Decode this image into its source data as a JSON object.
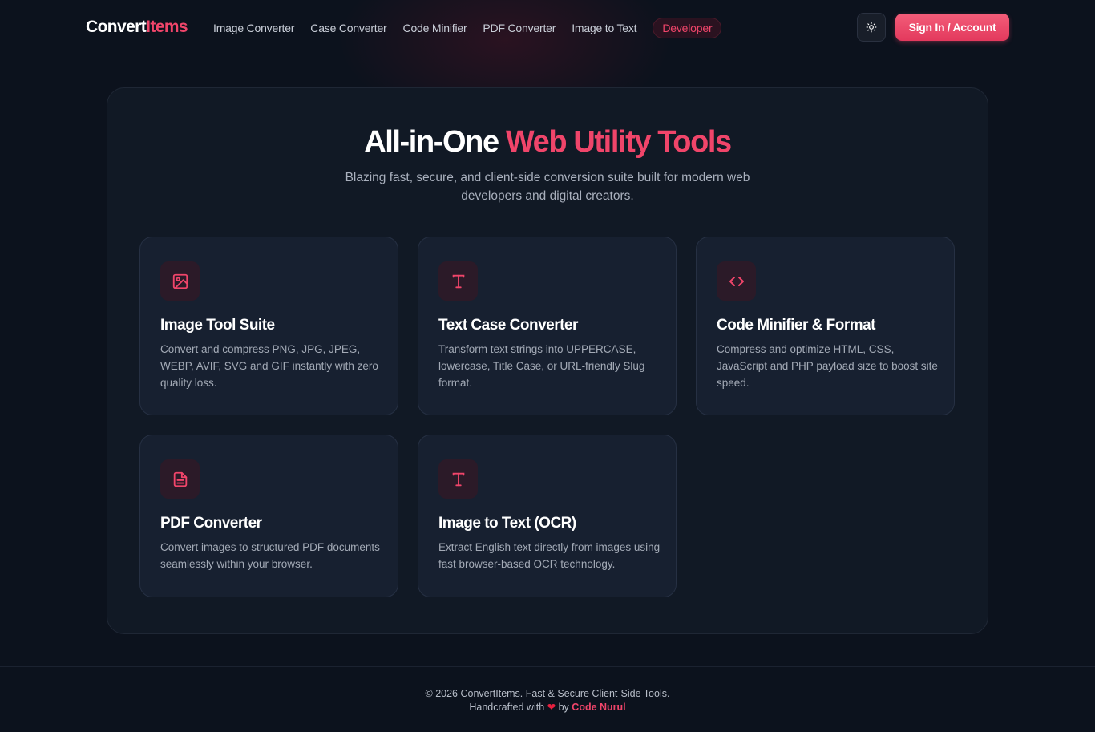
{
  "brand": {
    "part1": "Convert",
    "part2": "Items",
    "accent_color": "#f0456a"
  },
  "nav": {
    "links": [
      "Image Converter",
      "Case Converter",
      "Code Minifier",
      "PDF Converter",
      "Image to Text"
    ],
    "highlight": "Developer"
  },
  "header": {
    "theme_toggle_icon": "sun-icon",
    "signin_label": "Sign In / Account"
  },
  "hero": {
    "title_part1": "All-in-One ",
    "title_accent": "Web Utility Tools",
    "subtitle": "Blazing fast, secure, and client-side conversion suite built for modern web developers and digital creators."
  },
  "cards": [
    {
      "icon": "image-icon",
      "title": "Image Tool Suite",
      "desc": "Convert and compress PNG, JPG, JPEG, WEBP, AVIF, SVG and GIF instantly with zero quality loss."
    },
    {
      "icon": "text-t-icon",
      "title": "Text Case Converter",
      "desc": "Transform text strings into UPPERCASE, lowercase, Title Case, or URL-friendly Slug format."
    },
    {
      "icon": "code-icon",
      "title": "Code Minifier & Format",
      "desc": "Compress and optimize HTML, CSS, JavaScript and PHP payload size to boost site speed."
    },
    {
      "icon": "document-icon",
      "title": "PDF Converter",
      "desc": "Convert images to structured PDF documents seamlessly within your browser."
    },
    {
      "icon": "text-t-icon",
      "title": "Image to Text (OCR)",
      "desc": "Extract English text directly from images using fast browser-based OCR technology."
    }
  ],
  "footer": {
    "copyright": "© 2026 ConvertItems. Fast & Secure Client-Side Tools.",
    "handcrafted_prefix": "Handcrafted with",
    "heart": "❤",
    "by": "by",
    "author": "Code Nurul"
  }
}
